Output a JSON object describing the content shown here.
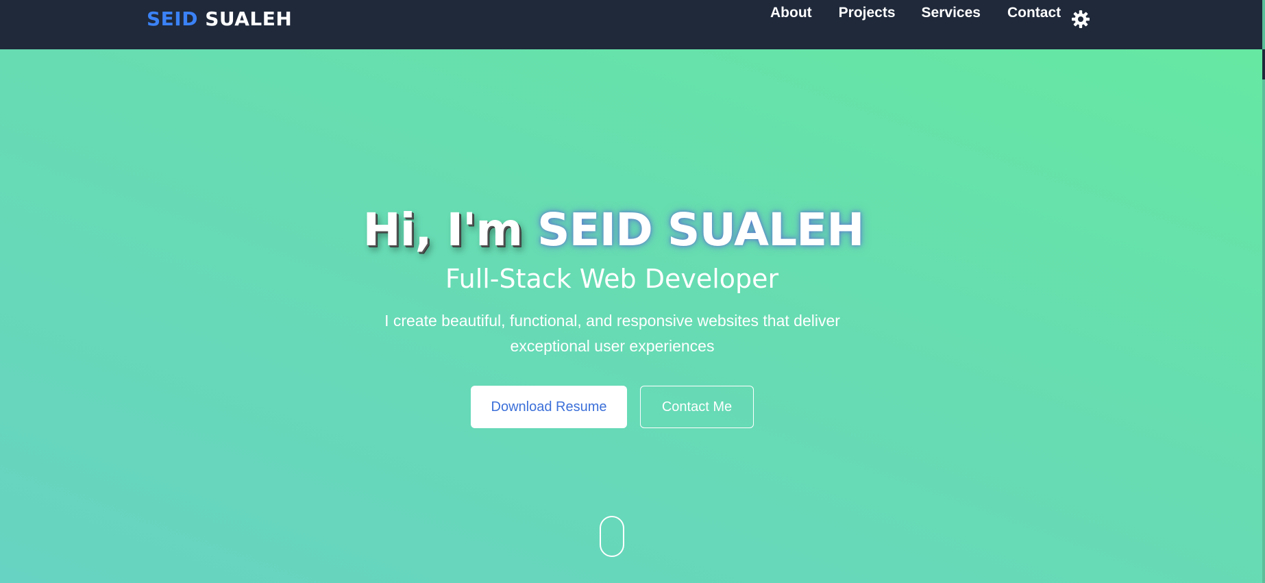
{
  "navbar": {
    "brand_first": "SEID",
    "brand_last": "SUALEH",
    "links": [
      "About",
      "Projects",
      "Services",
      "Contact"
    ],
    "theme_toggle_icon": "gear-icon"
  },
  "hero": {
    "greeting": "Hi, I'm",
    "name": "SEID SUALEH",
    "subtitle": "Full-Stack Web Developer",
    "description_line1": "I create beautiful, functional, and responsive websites that deliver",
    "description_line2": "exceptional user experiences",
    "primary_button": "Download Resume",
    "secondary_button": "Contact Me",
    "scroll_icon": "mouse-scroll-icon"
  },
  "colors": {
    "navbar_bg": "#1f293a",
    "brand_accent": "#3b82f6",
    "hero_gradient_start": "#66e8a2",
    "hero_gradient_end": "#67d3c2",
    "primary_button_text": "#3b6fd8"
  }
}
